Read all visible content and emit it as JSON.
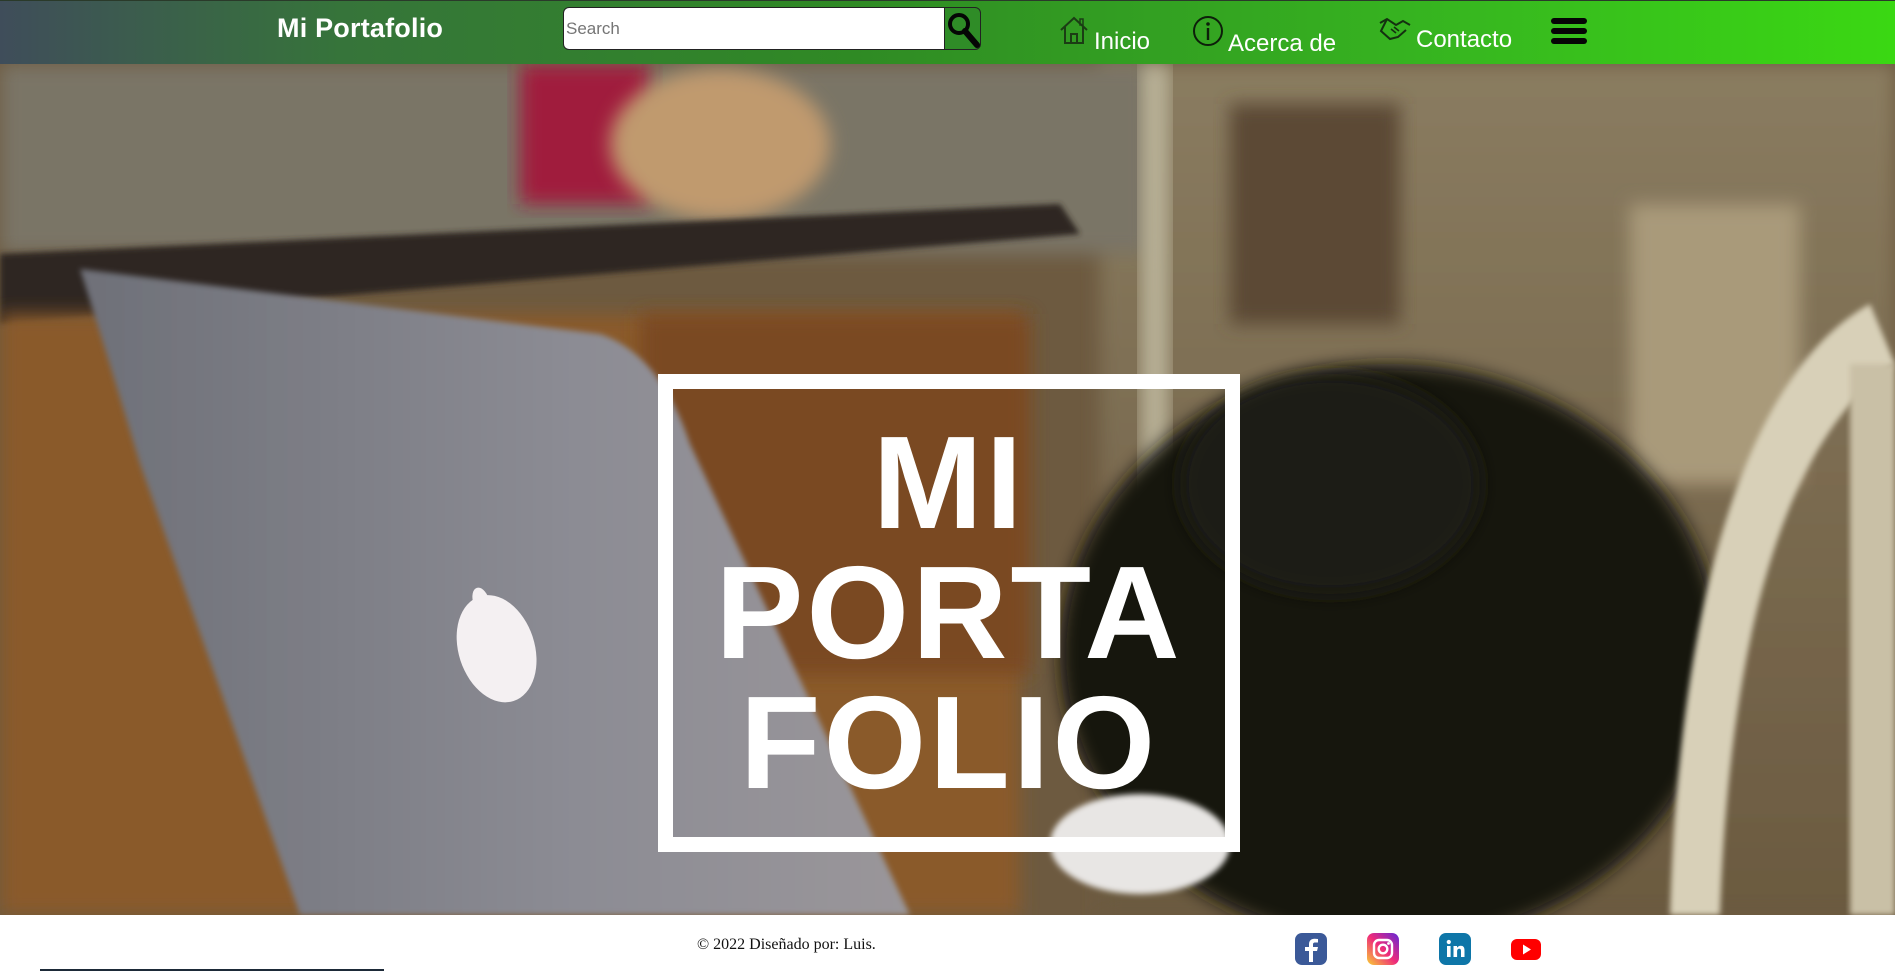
{
  "navbar": {
    "brand": "Mi Portafolio",
    "search_placeholder": "Search",
    "search_value": "",
    "links": [
      {
        "label": "Inicio",
        "icon": "home-icon"
      },
      {
        "label": "Acerca de",
        "icon": "info-icon"
      },
      {
        "label": "Contacto",
        "icon": "handshake-icon"
      }
    ],
    "menu_icon": "hamburger-menu-icon"
  },
  "hero": {
    "title_lines": [
      "MI",
      "PORTA",
      "FOLIO"
    ],
    "background": "photo of a black-and-white cat at a silver laptop in a kitchen"
  },
  "footer": {
    "copyright": "© 2022 Diseñado por: Luis.",
    "social": [
      {
        "name": "facebook-icon",
        "color": "#3b5998"
      },
      {
        "name": "instagram-icon",
        "color": "#e1306c"
      },
      {
        "name": "linkedin-icon",
        "color": "#0e76a8"
      },
      {
        "name": "youtube-icon",
        "color": "#ff0000"
      }
    ]
  },
  "colors": {
    "navbar_start": "#3f4d5a",
    "navbar_end": "#3ad813",
    "accent_green": "#2f8a24"
  }
}
